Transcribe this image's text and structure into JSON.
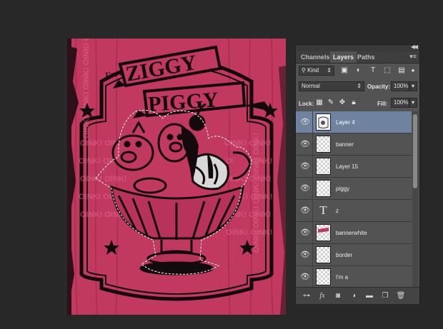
{
  "artwork": {
    "line_im_a": "I'm a",
    "line_ziggy": "ZIGGY",
    "line_piggy": "PIGGY",
    "oink_text": "OINK! OINK! OINK! OINK! OINK!",
    "colors": {
      "background": "#c2395f",
      "ink": "#120a0d"
    }
  },
  "panel": {
    "tabs": [
      {
        "label": "Channels",
        "active": false
      },
      {
        "label": "Layers",
        "active": true
      },
      {
        "label": "Paths",
        "active": false
      }
    ],
    "filter": {
      "kind_label": "Kind"
    },
    "blend_mode": "Normal",
    "opacity_label": "Opacity:",
    "opacity_value": "100%",
    "lock_label": "Lock:",
    "fill_label": "Fill:",
    "fill_value": "100%",
    "layers": [
      {
        "name": "Layer 4",
        "selected": true,
        "thumb": "art"
      },
      {
        "name": "banner",
        "selected": false,
        "thumb": "transparent"
      },
      {
        "name": "Layer 15",
        "selected": false,
        "thumb": "transparent"
      },
      {
        "name": "piggy",
        "selected": false,
        "thumb": "transparent"
      },
      {
        "name": "z",
        "selected": false,
        "thumb": "text"
      },
      {
        "name": "bannerwhite",
        "selected": false,
        "thumb": "pink"
      },
      {
        "name": "border",
        "selected": false,
        "thumb": "transparent"
      },
      {
        "name": "I'm a",
        "selected": false,
        "thumb": "transparent"
      }
    ],
    "accent_color": "#6f829f"
  }
}
